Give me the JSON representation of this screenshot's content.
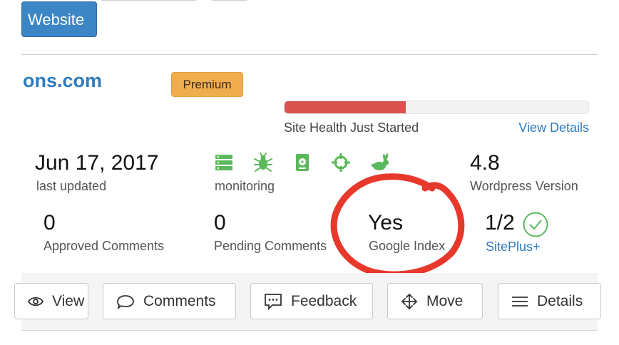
{
  "header": {
    "add_website_label": "Website"
  },
  "site": {
    "name": "ons.com",
    "plan_badge": "Premium",
    "health": {
      "label": "Site Health Just Started",
      "link": "View Details",
      "progress": 0.4
    }
  },
  "stats": {
    "last_updated": {
      "value": "Jun 17, 2017",
      "label": "last updated"
    },
    "monitoring": {
      "label": "monitoring",
      "icons": [
        "server-icon",
        "bug-icon",
        "hard-drive-icon",
        "crosshair-icon",
        "rabbit-icon"
      ]
    },
    "wordpress": {
      "value": "4.8",
      "label": "Wordpress Version"
    },
    "approved": {
      "value": "0",
      "label": "Approved Comments"
    },
    "pending": {
      "value": "0",
      "label": "Pending Comments"
    },
    "google": {
      "value": "Yes",
      "label": "Google Index"
    },
    "siteplus": {
      "value": "1/2",
      "label": "SitePlus+"
    }
  },
  "actions": {
    "view": "View",
    "comments": "Comments",
    "feedback": "Feedback",
    "move": "Move",
    "details": "Details"
  },
  "colors": {
    "accent": "#2e7bbf",
    "button_blue": "#3c86c6",
    "premium": "#f0ad4e",
    "health_bad": "#d9534f",
    "monitor_green": "#5cb85c",
    "annotation_red": "#e8382c"
  }
}
